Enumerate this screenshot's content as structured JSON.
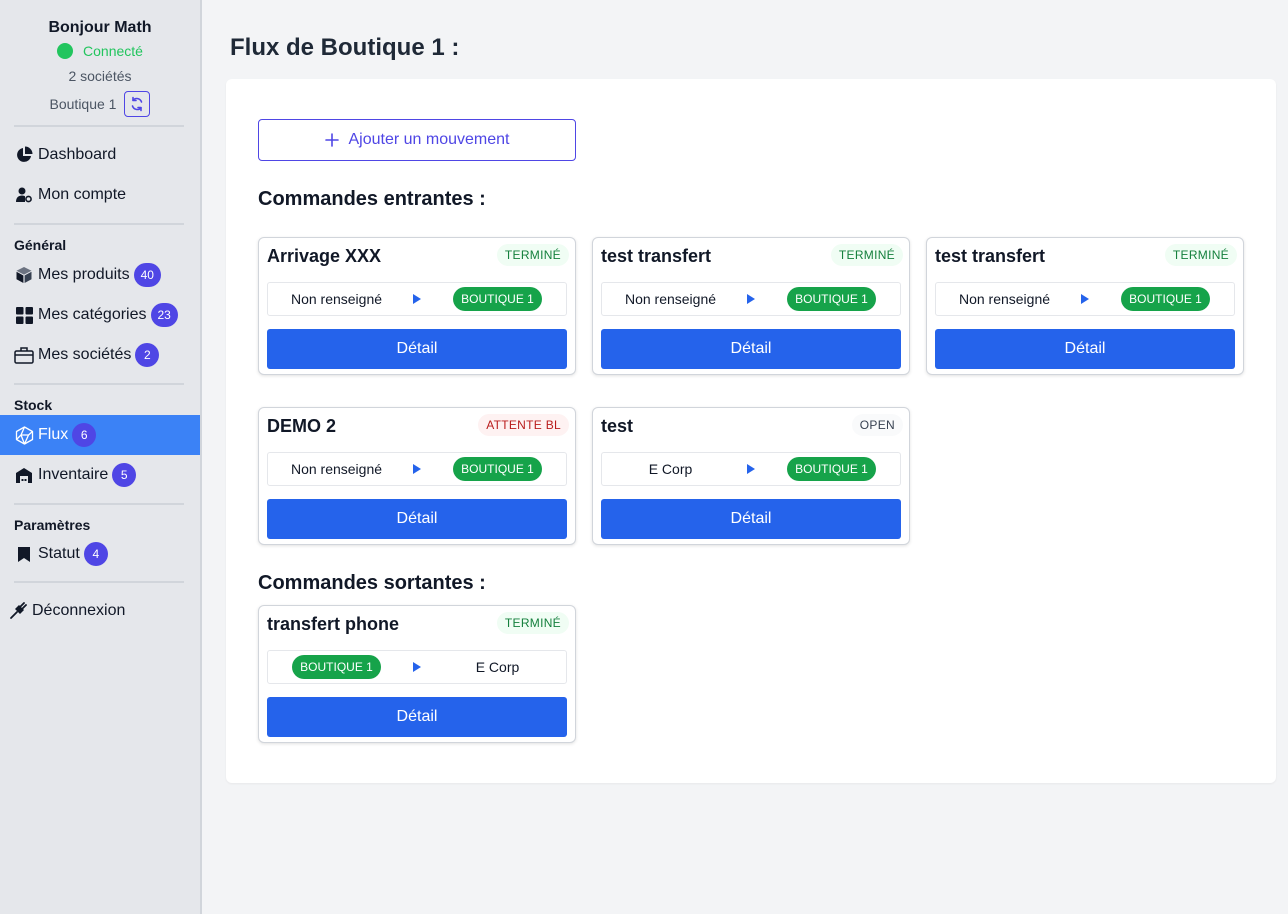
{
  "user": {
    "greeting": "Bonjour Math",
    "status": "Connecté",
    "companies": "2 sociétés",
    "shop": "Boutique 1"
  },
  "nav": {
    "dashboard": "Dashboard",
    "account": "Mon compte",
    "general_label": "Général",
    "products": {
      "label": "Mes produits",
      "count": "40"
    },
    "categories": {
      "label": "Mes catégories",
      "count": "23"
    },
    "companies": {
      "label": "Mes sociétés",
      "count": "2"
    },
    "stock_label": "Stock",
    "flux": {
      "label": "Flux",
      "count": "6"
    },
    "inventory": {
      "label": "Inventaire",
      "count": "5"
    },
    "settings_label": "Paramètres",
    "status": {
      "label": "Statut",
      "count": "4"
    },
    "logout": "Déconnexion"
  },
  "main": {
    "title": "Flux de Boutique 1 :",
    "add_button": "Ajouter un mouvement",
    "incoming_title": "Commandes entrantes :",
    "outgoing_title": "Commandes sortantes :",
    "detail_label": "Détail",
    "incoming": [
      {
        "title": "Arrivage XXX",
        "status": "TERMINÉ",
        "from": "Non renseigné",
        "to": "BOUTIQUE 1"
      },
      {
        "title": "test transfert",
        "status": "TERMINÉ",
        "from": "Non renseigné",
        "to": "BOUTIQUE 1"
      },
      {
        "title": "test transfert",
        "status": "TERMINÉ",
        "from": "Non renseigné",
        "to": "BOUTIQUE 1"
      },
      {
        "title": "DEMO 2",
        "status": "ATTENTE BL",
        "from": "Non renseigné",
        "to": "BOUTIQUE 1"
      },
      {
        "title": "test",
        "status": "OPEN",
        "from": "E Corp",
        "to": "BOUTIQUE 1"
      }
    ],
    "outgoing": [
      {
        "title": "transfert phone",
        "status": "TERMINÉ",
        "from": "BOUTIQUE 1",
        "to": "E Corp"
      }
    ]
  },
  "colors": {
    "active_nav": "#3b82f6",
    "badge": "#4f46e5",
    "primary_button": "#2563eb",
    "shop_pill": "#16a34a",
    "status_done": "#15803d",
    "status_wait": "#b91c1c"
  }
}
